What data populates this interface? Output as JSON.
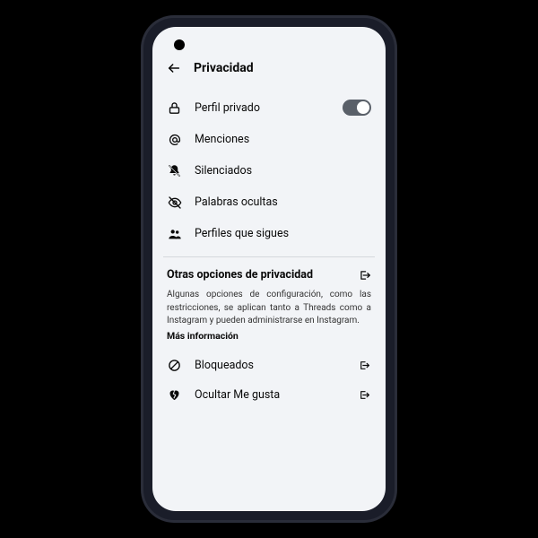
{
  "header": {
    "title": "Privacidad"
  },
  "rows": {
    "private_profile": "Perfil privado",
    "mentions": "Menciones",
    "muted": "Silenciados",
    "hidden_words": "Palabras ocultas",
    "profiles_following": "Perfiles que sigues"
  },
  "other_section": {
    "title": "Otras opciones de privacidad",
    "info": "Algunas opciones de configuración, como las restricciones, se aplican tanto a Threads como a Instagram y pueden administrarse en Instagram.",
    "more_info": "Más información",
    "blocked": "Bloqueados",
    "hide_likes": "Ocultar Me gusta"
  }
}
